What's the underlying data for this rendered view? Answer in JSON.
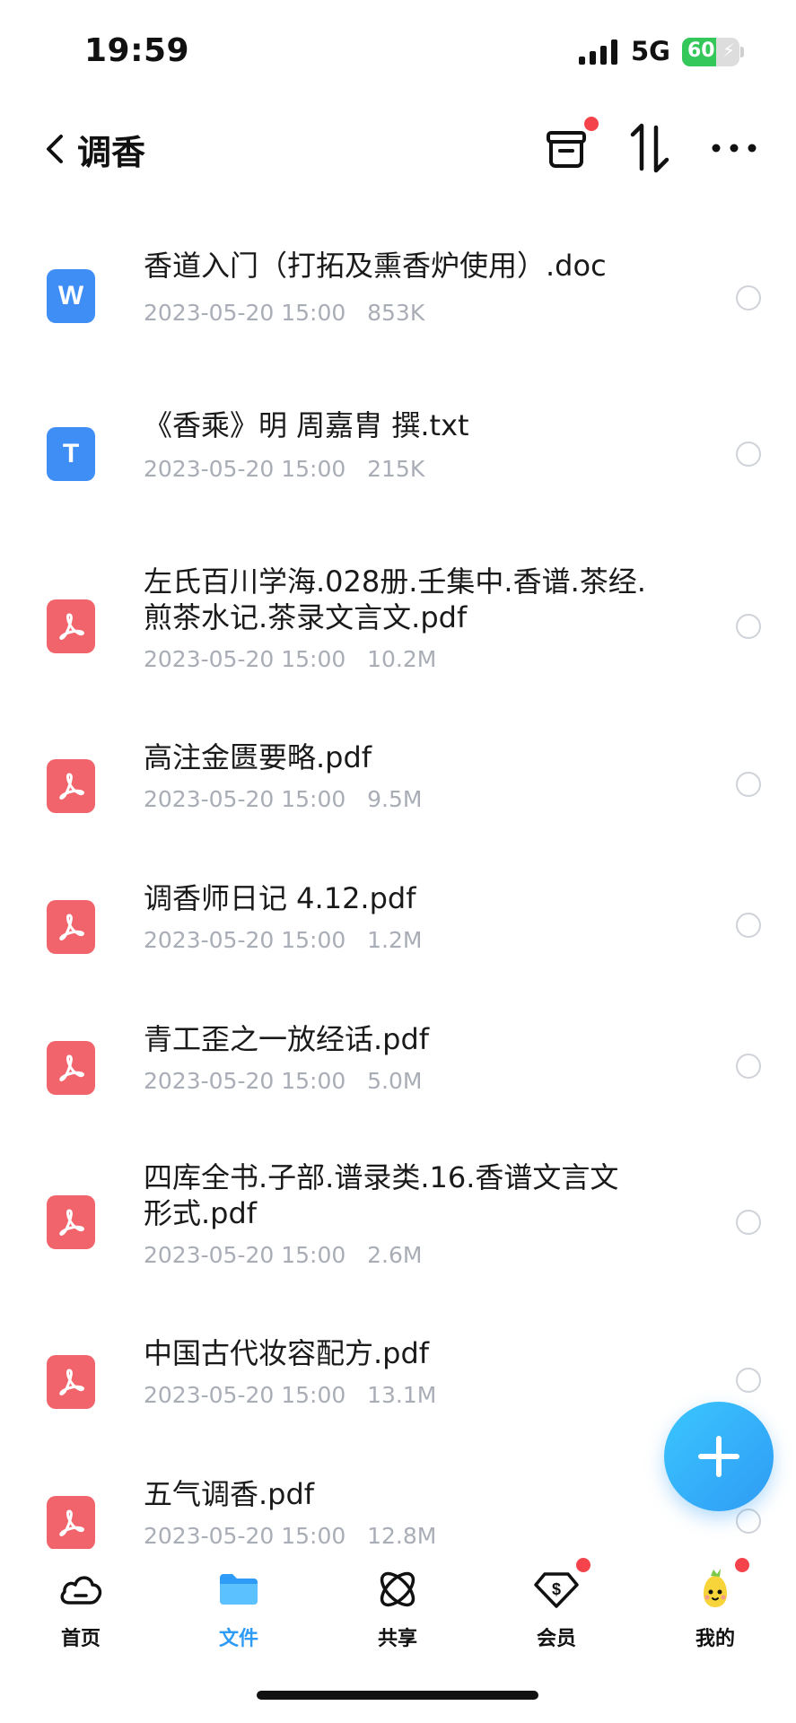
{
  "status_bar": {
    "time": "19:59",
    "network": "5G",
    "battery_level": 60,
    "battery_text": "60",
    "charging": true
  },
  "nav": {
    "title": "调香",
    "icons": [
      "chevron-left-icon",
      "archive-box-icon",
      "sort-icon",
      "more-icon"
    ],
    "archive_has_badge": true
  },
  "files": [
    {
      "name": "香道入门（打拓及熏香炉使用）.doc",
      "date": "2023-05-20 15:00",
      "size": "853K",
      "type": "doc",
      "icon_letter": "W"
    },
    {
      "name": "《香乘》明 周嘉胄 撰.txt",
      "date": "2023-05-20 15:00",
      "size": "215K",
      "type": "txt",
      "icon_letter": "T"
    },
    {
      "name": "左氏百川学海.028册.壬集中.香谱.茶经.煎茶水记.茶录文言文.pdf",
      "date": "2023-05-20 15:00",
      "size": "10.2M",
      "type": "pdf"
    },
    {
      "name": "高注金匮要略.pdf",
      "date": "2023-05-20 15:00",
      "size": "9.5M",
      "type": "pdf"
    },
    {
      "name": "调香师日记 4.12.pdf",
      "date": "2023-05-20 15:00",
      "size": "1.2M",
      "type": "pdf"
    },
    {
      "name": "青工歪之一放经话.pdf",
      "date": "2023-05-20 15:00",
      "size": "5.0M",
      "type": "pdf"
    },
    {
      "name": "四库全书.子部.谱录类.16.香谱文言文形式.pdf",
      "date": "2023-05-20 15:00",
      "size": "2.6M",
      "type": "pdf"
    },
    {
      "name": "中国古代妆容配方.pdf",
      "date": "2023-05-20 15:00",
      "size": "13.1M",
      "type": "pdf"
    },
    {
      "name": "五气调香.pdf",
      "date": "2023-05-20 15:00",
      "size": "12.8M",
      "type": "pdf"
    }
  ],
  "tabs": [
    {
      "label": "首页",
      "icon": "cloud-icon",
      "active": false,
      "badge": false
    },
    {
      "label": "文件",
      "icon": "folder-icon",
      "active": true,
      "badge": false
    },
    {
      "label": "共享",
      "icon": "share-orbit-icon",
      "active": false,
      "badge": false
    },
    {
      "label": "会员",
      "icon": "diamond-vip-icon",
      "active": false,
      "badge": true
    },
    {
      "label": "我的",
      "icon": "avatar-icon",
      "active": false,
      "badge": true
    }
  ],
  "colors": {
    "accent": "#2e9bf6",
    "pdf": "#f2646b",
    "doc": "#3f8ef5",
    "badge": "#f5434b",
    "meta_text": "#a9adb6"
  }
}
